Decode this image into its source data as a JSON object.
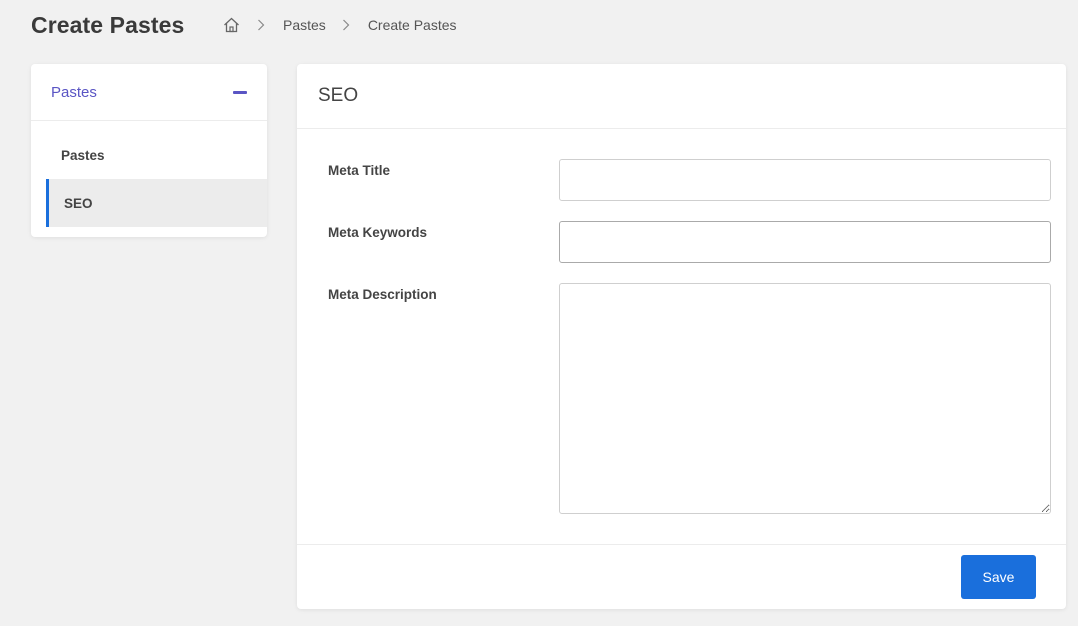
{
  "page": {
    "title": "Create Pastes"
  },
  "breadcrumb": {
    "home_icon": "home-icon",
    "items": [
      "Pastes",
      "Create Pastes"
    ]
  },
  "sidebar": {
    "title": "Pastes",
    "collapse_icon": "minus-icon",
    "items": [
      {
        "label": "Pastes",
        "active": false
      },
      {
        "label": "SEO",
        "active": true
      }
    ]
  },
  "main": {
    "title": "SEO",
    "fields": {
      "meta_title": {
        "label": "Meta Title",
        "value": ""
      },
      "meta_keywords": {
        "label": "Meta Keywords",
        "value": ""
      },
      "meta_description": {
        "label": "Meta Description",
        "value": ""
      }
    },
    "save_label": "Save"
  },
  "colors": {
    "accent": "#5a55c4",
    "primary_button": "#1a6fdc",
    "background": "#f1f1f1"
  }
}
